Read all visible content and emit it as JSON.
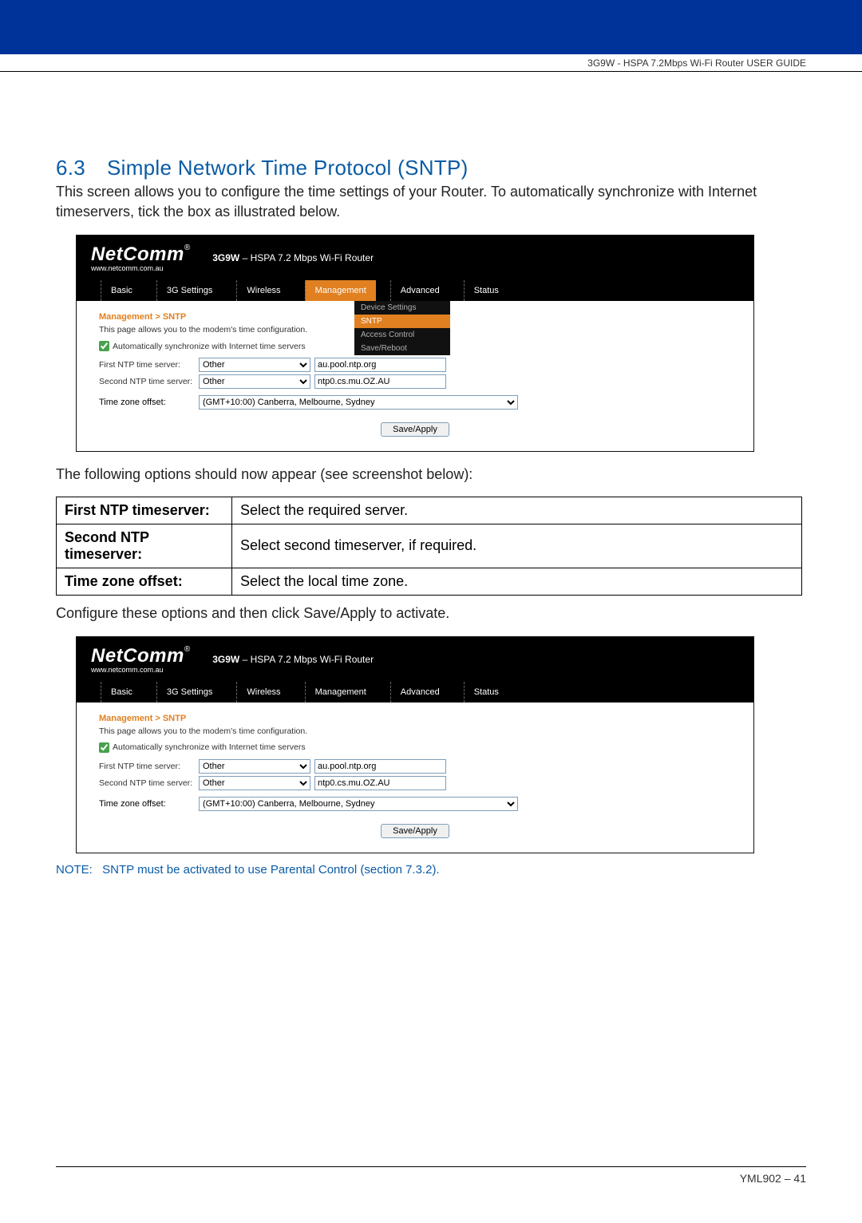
{
  "header": {
    "guide_title": "3G9W - HSPA 7.2Mbps Wi-Fi Router USER GUIDE"
  },
  "section": {
    "num": "6.3",
    "title": "Simple Network Time Protocol (SNTP)",
    "intro": "This screen allows you to configure the time settings of your Router.  To automatically synchronize with Internet timeservers, tick the box as illustrated below.",
    "after_first": "The following options should now appear (see screenshot below):",
    "after_table": "Configure these options and then click Save/Apply to activate."
  },
  "router": {
    "brand": "NetComm",
    "brand_tag": "®",
    "brand_url": "www.netcomm.com.au",
    "model_prefix": "3G9W",
    "model_rest": " – HSPA 7.2 Mbps Wi-Fi Router",
    "nav": {
      "basic": "Basic",
      "threeg": "3G Settings",
      "wireless": "Wireless",
      "management": "Management",
      "advanced": "Advanced",
      "status": "Status"
    },
    "submenu": {
      "device": "Device Settings",
      "sntp": "SNTP",
      "access": "Access Control",
      "save": "Save/Reboot"
    },
    "breadcrumb": {
      "a": "Management",
      "sep": ">",
      "b": "SNTP"
    },
    "desc": "This page allows you to the modem's time configuration.",
    "auto_sync": "Automatically synchronize with Internet time servers",
    "labels": {
      "first": "First NTP time server:",
      "second": "Second NTP time server:",
      "tz": "Time zone offset:"
    },
    "selects": {
      "first": "Other",
      "second": "Other",
      "tz": "(GMT+10:00) Canberra, Melbourne, Sydney"
    },
    "inputs": {
      "first": "au.pool.ntp.org",
      "second": "ntp0.cs.mu.OZ.AU"
    },
    "save_btn": "Save/Apply"
  },
  "options_table": [
    {
      "label": "First NTP timeserver:",
      "desc": "Select the required server."
    },
    {
      "label": "Second NTP timeserver:",
      "desc": "Select second timeserver, if required."
    },
    {
      "label": "Time zone offset:",
      "desc": "Select the local time zone."
    }
  ],
  "note": {
    "label": "NOTE:",
    "text": "SNTP must be activated to use Parental Control (section 7.3.2)."
  },
  "footer": {
    "doc": "YML902 – 41"
  }
}
